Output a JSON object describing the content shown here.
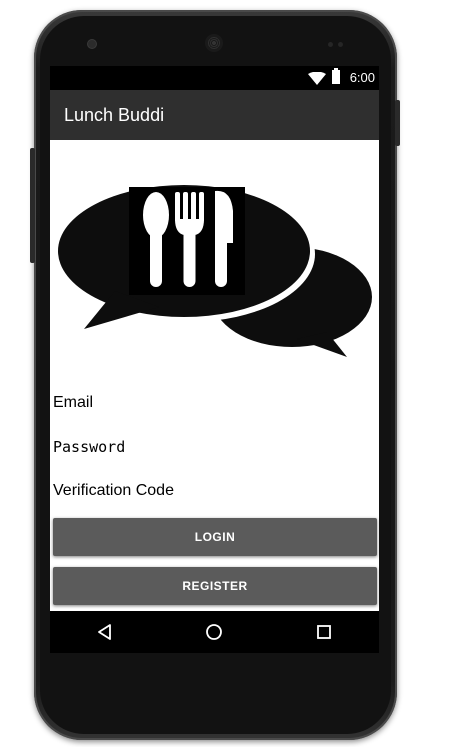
{
  "status_bar": {
    "time": "6:00",
    "icons": [
      "wifi-icon",
      "battery-icon"
    ]
  },
  "app_bar": {
    "title": "Lunch Buddi"
  },
  "logo": {
    "icon": "chat-bubbles-utensils-logo",
    "utensils": [
      "spoon-icon",
      "fork-icon",
      "knife-icon"
    ]
  },
  "form": {
    "email_placeholder": "Email",
    "password_placeholder": "Password",
    "verification_placeholder": "Verification Code"
  },
  "buttons": {
    "login": "LOGIN",
    "register": "REGISTER"
  },
  "nav_bar": {
    "icons": [
      "back-icon",
      "home-icon",
      "recent-apps-icon"
    ]
  },
  "colors": {
    "app_bar": "#2f2f2f",
    "status_bar": "#000000",
    "button": "#5b5b5b",
    "button_text": "#ffffff",
    "background": "#ffffff"
  }
}
